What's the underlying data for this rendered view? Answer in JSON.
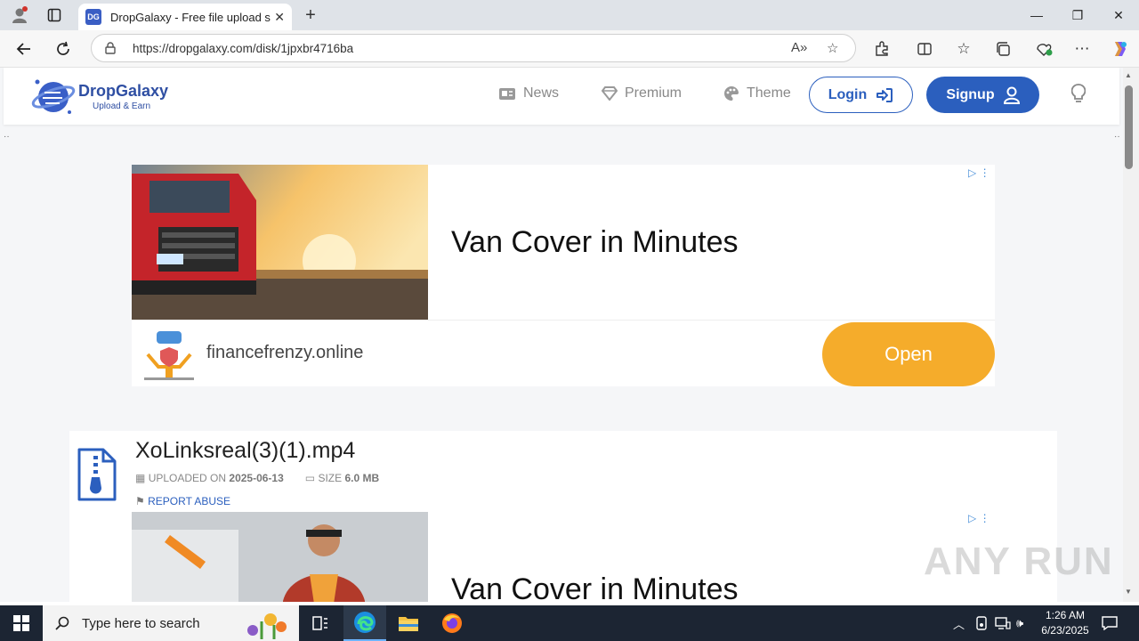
{
  "browser": {
    "tab_title": "DropGalaxy - Free file upload serv",
    "tab_favicon": "DG",
    "url": "https://dropgalaxy.com/disk/1jpxbr4716ba"
  },
  "site": {
    "logo_name": "DropGalaxy",
    "logo_tagline": "Upload & Earn",
    "menu": {
      "news": "News",
      "premium": "Premium",
      "theme": "Theme"
    },
    "login_label": "Login",
    "signup_label": "Signup"
  },
  "ad1": {
    "headline": "Van Cover in Minutes",
    "advertiser": "financefrenzy.online",
    "cta": "Open"
  },
  "file": {
    "name": "XoLinksreal(3)(1).mp4",
    "uploaded_label": "UPLOADED ON",
    "uploaded_date": "2025-06-13",
    "size_label": "SIZE",
    "size_value": "6.0 MB",
    "report_label": "REPORT ABUSE"
  },
  "ad2": {
    "headline": "Van Cover in Minutes"
  },
  "watermark": "ANY RUN",
  "taskbar": {
    "search_placeholder": "Type here to search",
    "time": "1:26 AM",
    "date": "6/23/2025"
  },
  "colors": {
    "brand_blue": "#2b5fbe",
    "cta_orange": "#f5ac2b",
    "taskbar": "#1c2533"
  }
}
